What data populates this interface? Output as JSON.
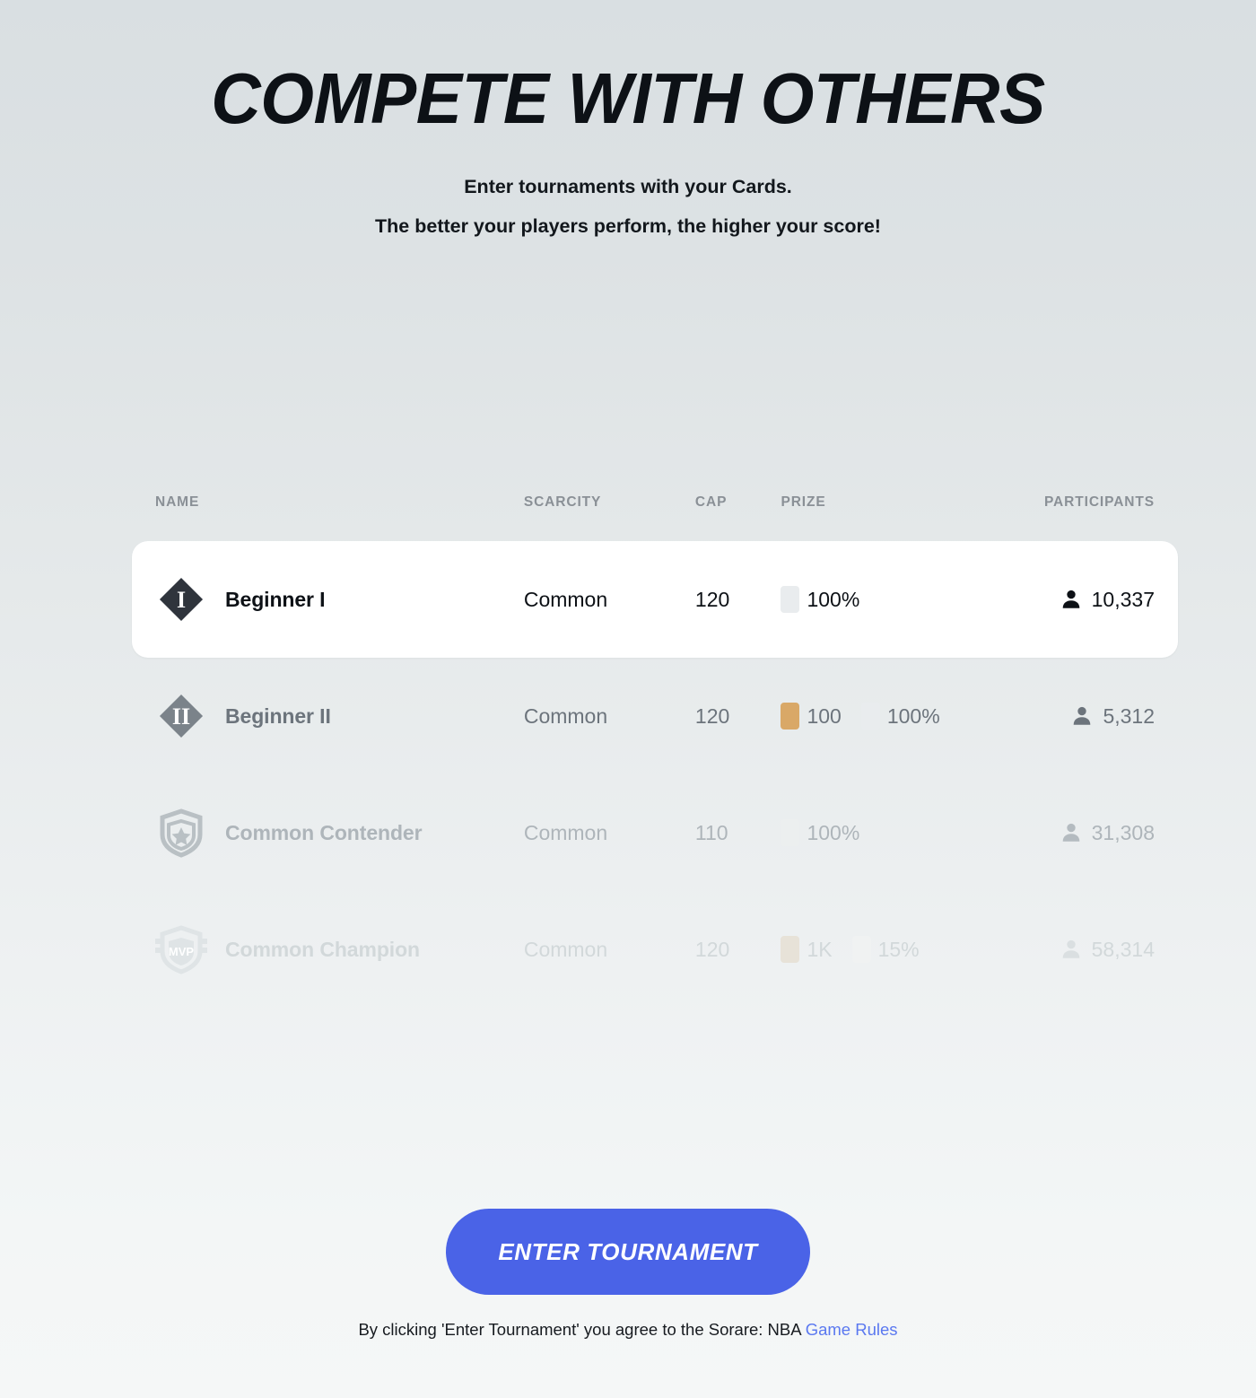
{
  "hero": {
    "title": "COMPETE WITH OTHERS",
    "subtitle_line1": "Enter tournaments with your Cards.",
    "subtitle_line2": "The better your players perform, the higher your score!"
  },
  "table": {
    "headers": {
      "name": "NAME",
      "scarcity": "SCARCITY",
      "cap": "CAP",
      "prize": "PRIZE",
      "participants": "PARTICIPANTS"
    },
    "rows": [
      {
        "name": "Beginner I",
        "badge_icon": "diamond-one-icon",
        "scarcity": "Common",
        "cap": "120",
        "prizes": [
          {
            "chip_color": "#e9ecee",
            "label": "100%"
          }
        ],
        "participants": "10,337",
        "selected": true
      },
      {
        "name": "Beginner II",
        "badge_icon": "diamond-two-icon",
        "scarcity": "Common",
        "cap": "120",
        "prizes": [
          {
            "chip_color": "#d9a867",
            "label": "100"
          },
          {
            "chip_color": "#e9ecee",
            "label": "100%"
          }
        ],
        "participants": "5,312",
        "selected": false
      },
      {
        "name": "Common Contender",
        "badge_icon": "shield-star-icon",
        "scarcity": "Common",
        "cap": "110",
        "prizes": [
          {
            "chip_color": "#ecefef",
            "label": "100%"
          }
        ],
        "participants": "31,308",
        "selected": false
      },
      {
        "name": "Common Champion",
        "badge_icon": "shield-mvp-icon",
        "scarcity": "Common",
        "cap": "120",
        "prizes": [
          {
            "chip_color": "#e7e2d8",
            "label": "1K"
          },
          {
            "chip_color": "#f0f2f2",
            "label": "15%"
          }
        ],
        "participants": "58,314",
        "selected": false
      }
    ]
  },
  "cta": {
    "button_label": "ENTER TOURNAMENT",
    "legal_text": "By clicking 'Enter Tournament' you agree to the Sorare: NBA ",
    "legal_link": "Game Rules"
  },
  "colors": {
    "accent": "#4a63e7",
    "link": "#5a78f0",
    "badge_tier1": "#2f343c",
    "badge_tier2": "#7b838a"
  }
}
